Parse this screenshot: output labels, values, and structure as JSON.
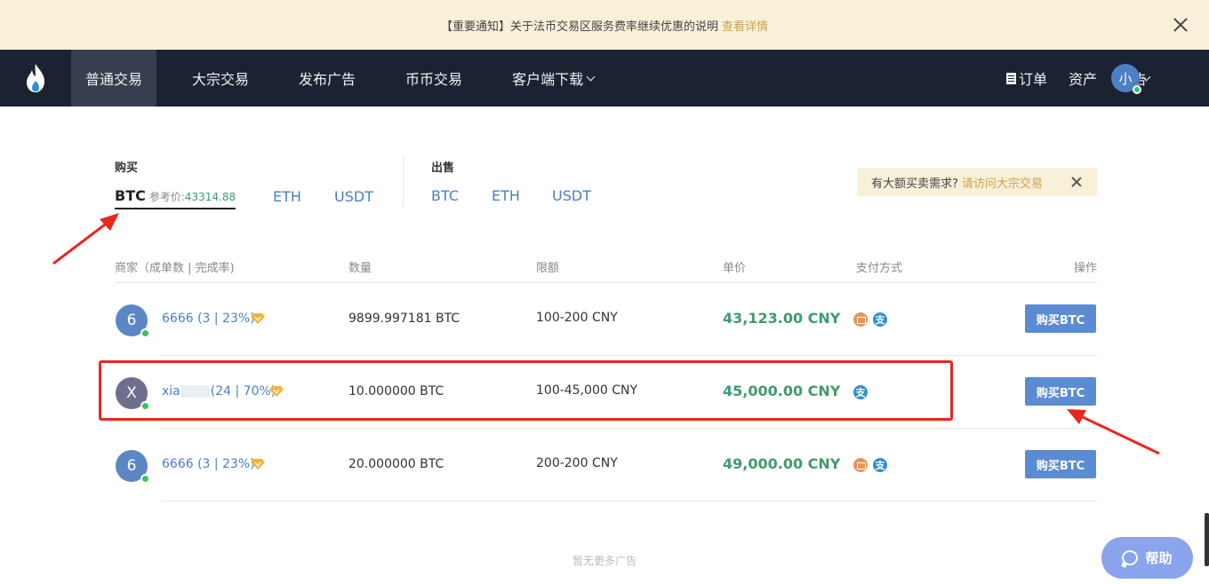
{
  "notice": {
    "text": "【重要通知】关于法币交易区服务费率继续优惠的说明",
    "link": "查看详情"
  },
  "nav": {
    "items": [
      {
        "label": "普通交易",
        "active": true
      },
      {
        "label": "大宗交易"
      },
      {
        "label": "发布广告"
      },
      {
        "label": "币币交易"
      },
      {
        "label": "客户端下载"
      }
    ],
    "right": {
      "orders": "订单",
      "assets": "资产",
      "ads": "广告",
      "avatar": "小"
    }
  },
  "buy": {
    "label": "购买",
    "tabs": [
      "BTC",
      "ETH",
      "USDT"
    ],
    "active": "BTC",
    "ref_label": "参考价:",
    "ref_price": "43314.88"
  },
  "sell": {
    "label": "出售",
    "tabs": [
      "BTC",
      "ETH",
      "USDT"
    ]
  },
  "bulk_tip": {
    "text": "有大额买卖需求?",
    "link": "请访问大宗交易"
  },
  "table": {
    "headers": [
      "商家（成单数 | 完成率)",
      "数量",
      "限额",
      "单价",
      "支付方式",
      "操作"
    ],
    "rows": [
      {
        "avatar": "6",
        "name": "6666",
        "stats": "(3 | 23%)",
        "qty": "9899.997181 BTC",
        "limit": "100-200 CNY",
        "price": "43,123.00 CNY",
        "payments": [
          "bank",
          "alipay"
        ],
        "action": "购买BTC"
      },
      {
        "avatar": "X",
        "name_prefix": "xia",
        "stats": "(24 | 70%)",
        "qty": "10.000000 BTC",
        "limit": "100-45,000 CNY",
        "price": "45,000.00 CNY",
        "payments": [
          "alipay"
        ],
        "action": "购买BTC"
      },
      {
        "avatar": "6",
        "name": "6666",
        "stats": "(3 | 23%)",
        "qty": "20.000000 BTC",
        "limit": "200-200 CNY",
        "price": "49,000.00 CNY",
        "payments": [
          "bank",
          "alipay"
        ],
        "action": "购买BTC"
      }
    ],
    "footer": "暂无更多广告"
  },
  "help": {
    "label": "帮助"
  },
  "colors": {
    "nav_bg": "#1b2333",
    "notice_bg": "#f8f0d9",
    "price_green": "#3f9b6e",
    "link_blue": "#4c7ec7",
    "button_blue": "#5b8cd3",
    "annotation_red": "#e8271f"
  }
}
